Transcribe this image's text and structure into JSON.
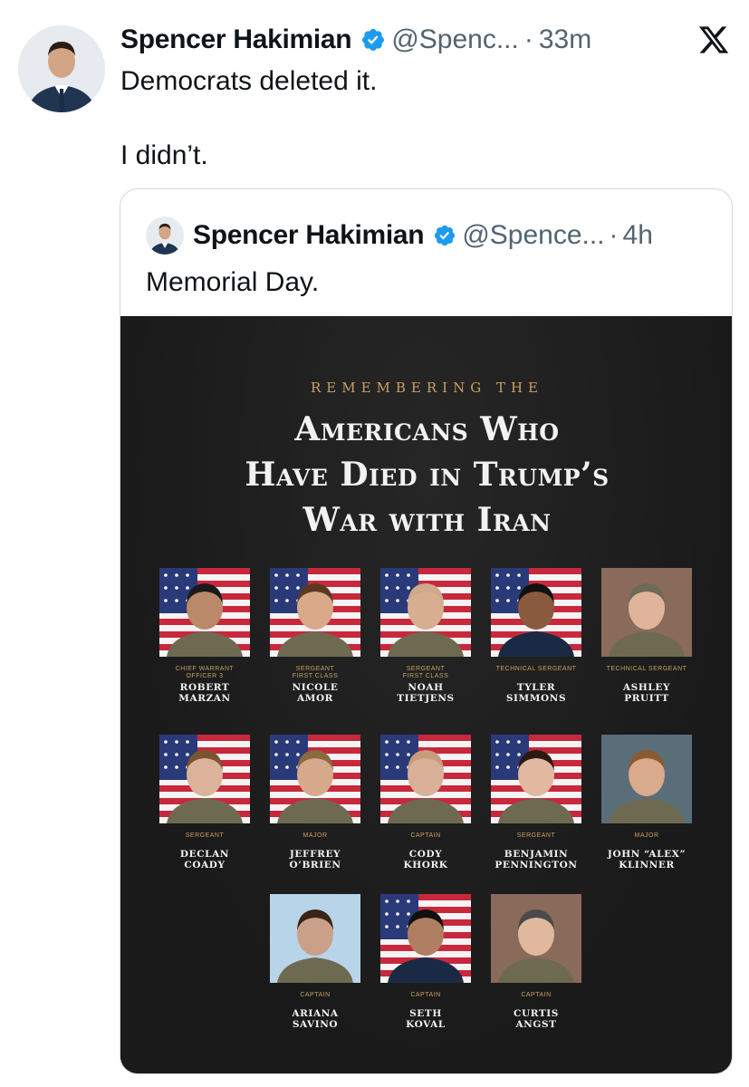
{
  "tweet": {
    "author_name": "Spencer Hakimian",
    "handle": "@Spenc...",
    "dot": "·",
    "time": "33m",
    "lines": [
      "Democrats deleted it.",
      "I didn’t."
    ],
    "avatar_icon": "profile-photo",
    "verified_icon": "verified-badge-icon",
    "logo_icon": "x-logo-icon"
  },
  "quote": {
    "author_name": "Spencer Hakimian",
    "handle": "@Spence...",
    "dot": "·",
    "time": "4h",
    "text": "Memorial Day."
  },
  "image": {
    "kicker": "REMEMBERING THE",
    "headline": [
      "Americans Who",
      "Have Died in Trump’s",
      "War with Iran"
    ],
    "people": [
      {
        "rank": [
          "Chief Warrant",
          "Officer 3"
        ],
        "name": [
          "ROBERT",
          "MARZAN"
        ],
        "flag": true
      },
      {
        "rank": [
          "Sergeant",
          "First Class"
        ],
        "name": [
          "NICOLE",
          "AMOR"
        ],
        "flag": true
      },
      {
        "rank": [
          "Sergeant",
          "First Class"
        ],
        "name": [
          "NOAH",
          "TIETJENS"
        ],
        "flag": true
      },
      {
        "rank": [
          "Technical Sergeant"
        ],
        "name": [
          "TYLER",
          "SIMMONS"
        ],
        "flag": true
      },
      {
        "rank": [
          "Technical Sergeant"
        ],
        "name": [
          "ASHLEY",
          "PRUITT"
        ],
        "flag": false
      },
      {
        "rank": [
          "Sergeant"
        ],
        "name": [
          "DECLAN",
          "COADY"
        ],
        "flag": true
      },
      {
        "rank": [
          "Major"
        ],
        "name": [
          "JEFFREY",
          "O’BRIEN"
        ],
        "flag": true
      },
      {
        "rank": [
          "Captain"
        ],
        "name": [
          "CODY",
          "KHORK"
        ],
        "flag": true
      },
      {
        "rank": [
          "Sergeant"
        ],
        "name": [
          "BENJAMIN",
          "PENNINGTON"
        ],
        "flag": true
      },
      {
        "rank": [
          "Major"
        ],
        "name": [
          "JOHN “ALEX”",
          "KLINNER"
        ],
        "flag": false
      },
      {
        "rank": [
          "Captain"
        ],
        "name": [
          "ARIANA",
          "SAVINO"
        ],
        "flag": false
      },
      {
        "rank": [
          "Captain"
        ],
        "name": [
          "SETH",
          "KOVAL"
        ],
        "flag": true
      },
      {
        "rank": [
          "Captain"
        ],
        "name": [
          "CURTIS",
          "ANGST"
        ],
        "flag": false
      }
    ]
  },
  "colors": {
    "text": "#0f1419",
    "muted": "#536471",
    "verified": "#1d9bf0",
    "image_bg": "#1b1b1b",
    "gold": "#c8a060"
  }
}
